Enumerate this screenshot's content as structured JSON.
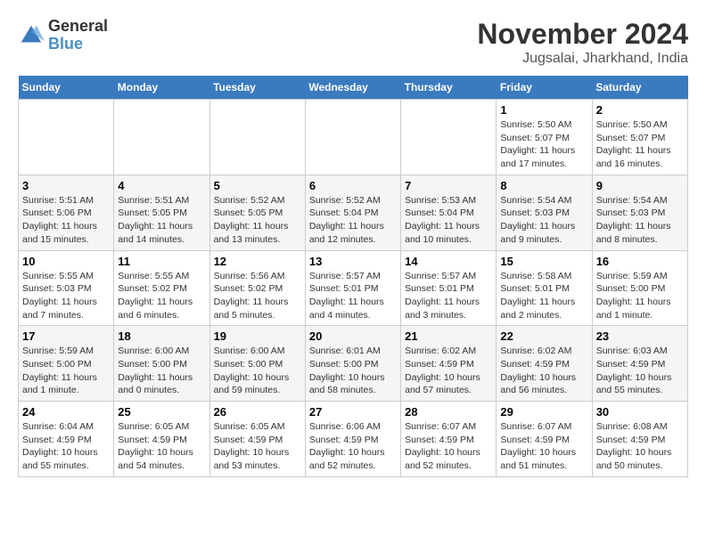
{
  "header": {
    "logo": {
      "general": "General",
      "blue": "Blue"
    },
    "title": "November 2024",
    "location": "Jugsalai, Jharkhand, India"
  },
  "weekdays": [
    "Sunday",
    "Monday",
    "Tuesday",
    "Wednesday",
    "Thursday",
    "Friday",
    "Saturday"
  ],
  "weeks": [
    [
      {
        "day": "",
        "info": ""
      },
      {
        "day": "",
        "info": ""
      },
      {
        "day": "",
        "info": ""
      },
      {
        "day": "",
        "info": ""
      },
      {
        "day": "",
        "info": ""
      },
      {
        "day": "1",
        "info": "Sunrise: 5:50 AM\nSunset: 5:07 PM\nDaylight: 11 hours and 17 minutes."
      },
      {
        "day": "2",
        "info": "Sunrise: 5:50 AM\nSunset: 5:07 PM\nDaylight: 11 hours and 16 minutes."
      }
    ],
    [
      {
        "day": "3",
        "info": "Sunrise: 5:51 AM\nSunset: 5:06 PM\nDaylight: 11 hours and 15 minutes."
      },
      {
        "day": "4",
        "info": "Sunrise: 5:51 AM\nSunset: 5:05 PM\nDaylight: 11 hours and 14 minutes."
      },
      {
        "day": "5",
        "info": "Sunrise: 5:52 AM\nSunset: 5:05 PM\nDaylight: 11 hours and 13 minutes."
      },
      {
        "day": "6",
        "info": "Sunrise: 5:52 AM\nSunset: 5:04 PM\nDaylight: 11 hours and 12 minutes."
      },
      {
        "day": "7",
        "info": "Sunrise: 5:53 AM\nSunset: 5:04 PM\nDaylight: 11 hours and 10 minutes."
      },
      {
        "day": "8",
        "info": "Sunrise: 5:54 AM\nSunset: 5:03 PM\nDaylight: 11 hours and 9 minutes."
      },
      {
        "day": "9",
        "info": "Sunrise: 5:54 AM\nSunset: 5:03 PM\nDaylight: 11 hours and 8 minutes."
      }
    ],
    [
      {
        "day": "10",
        "info": "Sunrise: 5:55 AM\nSunset: 5:03 PM\nDaylight: 11 hours and 7 minutes."
      },
      {
        "day": "11",
        "info": "Sunrise: 5:55 AM\nSunset: 5:02 PM\nDaylight: 11 hours and 6 minutes."
      },
      {
        "day": "12",
        "info": "Sunrise: 5:56 AM\nSunset: 5:02 PM\nDaylight: 11 hours and 5 minutes."
      },
      {
        "day": "13",
        "info": "Sunrise: 5:57 AM\nSunset: 5:01 PM\nDaylight: 11 hours and 4 minutes."
      },
      {
        "day": "14",
        "info": "Sunrise: 5:57 AM\nSunset: 5:01 PM\nDaylight: 11 hours and 3 minutes."
      },
      {
        "day": "15",
        "info": "Sunrise: 5:58 AM\nSunset: 5:01 PM\nDaylight: 11 hours and 2 minutes."
      },
      {
        "day": "16",
        "info": "Sunrise: 5:59 AM\nSunset: 5:00 PM\nDaylight: 11 hours and 1 minute."
      }
    ],
    [
      {
        "day": "17",
        "info": "Sunrise: 5:59 AM\nSunset: 5:00 PM\nDaylight: 11 hours and 1 minute."
      },
      {
        "day": "18",
        "info": "Sunrise: 6:00 AM\nSunset: 5:00 PM\nDaylight: 11 hours and 0 minutes."
      },
      {
        "day": "19",
        "info": "Sunrise: 6:00 AM\nSunset: 5:00 PM\nDaylight: 10 hours and 59 minutes."
      },
      {
        "day": "20",
        "info": "Sunrise: 6:01 AM\nSunset: 5:00 PM\nDaylight: 10 hours and 58 minutes."
      },
      {
        "day": "21",
        "info": "Sunrise: 6:02 AM\nSunset: 4:59 PM\nDaylight: 10 hours and 57 minutes."
      },
      {
        "day": "22",
        "info": "Sunrise: 6:02 AM\nSunset: 4:59 PM\nDaylight: 10 hours and 56 minutes."
      },
      {
        "day": "23",
        "info": "Sunrise: 6:03 AM\nSunset: 4:59 PM\nDaylight: 10 hours and 55 minutes."
      }
    ],
    [
      {
        "day": "24",
        "info": "Sunrise: 6:04 AM\nSunset: 4:59 PM\nDaylight: 10 hours and 55 minutes."
      },
      {
        "day": "25",
        "info": "Sunrise: 6:05 AM\nSunset: 4:59 PM\nDaylight: 10 hours and 54 minutes."
      },
      {
        "day": "26",
        "info": "Sunrise: 6:05 AM\nSunset: 4:59 PM\nDaylight: 10 hours and 53 minutes."
      },
      {
        "day": "27",
        "info": "Sunrise: 6:06 AM\nSunset: 4:59 PM\nDaylight: 10 hours and 52 minutes."
      },
      {
        "day": "28",
        "info": "Sunrise: 6:07 AM\nSunset: 4:59 PM\nDaylight: 10 hours and 52 minutes."
      },
      {
        "day": "29",
        "info": "Sunrise: 6:07 AM\nSunset: 4:59 PM\nDaylight: 10 hours and 51 minutes."
      },
      {
        "day": "30",
        "info": "Sunrise: 6:08 AM\nSunset: 4:59 PM\nDaylight: 10 hours and 50 minutes."
      }
    ]
  ]
}
